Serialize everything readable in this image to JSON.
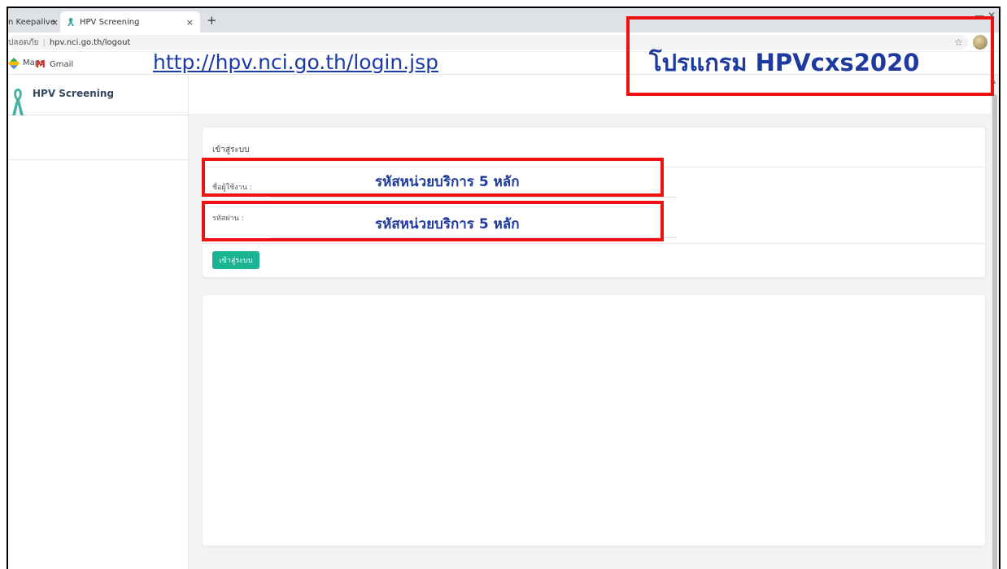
{
  "browser": {
    "tabs": [
      {
        "title": "n Keepalive",
        "close": "×"
      },
      {
        "title": "HPV Screening",
        "close": "×"
      }
    ],
    "new_tab": "+",
    "window_controls": "—   ✕",
    "address": {
      "secure_label": "ปลอดภัย",
      "url": "hpv.nci.go.th/logout"
    },
    "bookmarks": [
      {
        "label": "Maps"
      },
      {
        "label": "Gmail"
      }
    ],
    "star_icon": "☆",
    "menu_icon": "⋮"
  },
  "sidebar": {
    "brand": "HPV Screening"
  },
  "login_card": {
    "title": "เข้าสู่ระบบ",
    "username_label": "ชื่อผู้ใช้งาน :",
    "password_label": "รหัสผ่าน :",
    "submit_label": "เข้าสู่ระบบ"
  },
  "annotations": {
    "program_name": "โปรแกรม HPVcxs2020",
    "username_hint": "รหัสหน่วยบริการ 5 หลัก",
    "password_hint": "รหัสหน่วยบริการ 5 หลัก",
    "login_url": "http://hpv.nci.go.th/login.jsp",
    "box_color": "#ee1111",
    "text_color": "#1f3a9e"
  },
  "colors": {
    "accent_button": "#1ab394",
    "brand_text": "#34495e"
  }
}
